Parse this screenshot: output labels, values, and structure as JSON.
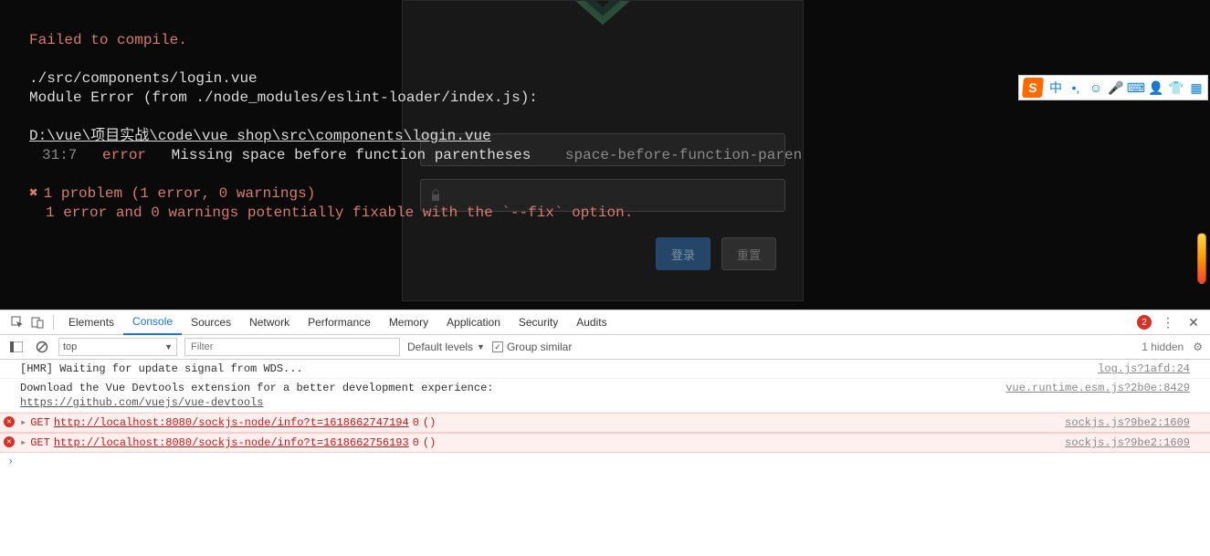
{
  "overlay": {
    "heading": "Failed to compile.",
    "file": "./src/components/login.vue",
    "module_error": "Module Error (from ./node_modules/eslint-loader/index.js):",
    "path": "D:\\vue\\项目实战\\code\\vue_shop\\src\\components\\login.vue",
    "line_col": "31:7",
    "level": "error",
    "message": "Missing space before function parentheses",
    "rule": "space-before-function-paren",
    "cross": "✖",
    "summary": "1 problem (1 error, 0 warnings)",
    "fixable": "1 error and 0 warnings potentially fixable with the `--fix` option."
  },
  "login": {
    "btn1": "登录",
    "btn2": "重置"
  },
  "ime": {
    "s": "S",
    "lang": "中"
  },
  "devtools": {
    "tabs": [
      "Elements",
      "Console",
      "Sources",
      "Network",
      "Performance",
      "Memory",
      "Application",
      "Security",
      "Audits"
    ],
    "active_tab": "Console",
    "error_count": "2",
    "toolbar": {
      "context": "top",
      "filter_placeholder": "Filter",
      "levels": "Default levels",
      "group": "Group similar",
      "hidden": "1 hidden"
    },
    "messages": [
      {
        "type": "log",
        "text": "[HMR] Waiting for update signal from WDS...",
        "src": "log.js?1afd:24"
      },
      {
        "type": "log",
        "text": "Download the Vue Devtools extension for a better development experience:",
        "link": "https://github.com/vuejs/vue-devtools",
        "src": "vue.runtime.esm.js?2b0e:8429"
      },
      {
        "type": "error",
        "method": "GET",
        "url": "http://localhost:8080/sockjs-node/info?t=1618662747194",
        "status": "0",
        "paren": "()",
        "src": "sockjs.js?9be2:1609"
      },
      {
        "type": "error",
        "method": "GET",
        "url": "http://localhost:8080/sockjs-node/info?t=1618662756193",
        "status": "0",
        "paren": "()",
        "src": "sockjs.js?9be2:1609"
      }
    ],
    "prompt": "›"
  }
}
